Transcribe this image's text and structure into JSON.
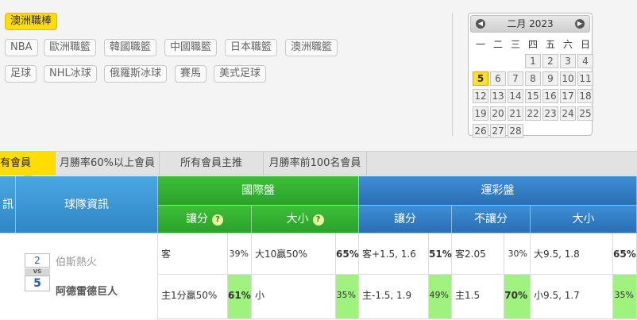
{
  "filters": {
    "active": "澳洲職棒",
    "row1": [
      "NBA",
      "歐洲職籃",
      "韓國職籃",
      "中國職籃",
      "日本職籃",
      "澳洲職籃"
    ],
    "row2": [
      "足球",
      "NHL冰球",
      "俄羅斯冰球",
      "賽馬",
      "美式足球"
    ]
  },
  "calendar": {
    "month_label": "二月 2023",
    "weekdays": [
      "一",
      "二",
      "三",
      "四",
      "五",
      "六",
      "日"
    ],
    "days": [
      "1",
      "2",
      "3",
      "4",
      "5",
      "6",
      "7",
      "8",
      "9",
      "10",
      "11",
      "12",
      "13",
      "14",
      "15",
      "16",
      "17",
      "18",
      "19",
      "20",
      "21",
      "22",
      "23",
      "24",
      "25",
      "26",
      "27",
      "28"
    ],
    "today": "5"
  },
  "tabs": [
    "有會員",
    "月勝率60%以上會員",
    "所有會員主推",
    "月勝率前100名會員"
  ],
  "table": {
    "col_left": "訊",
    "col_team": "球隊資訊",
    "group_intl": "國際盤",
    "group_sports": "運彩盤",
    "sub_intl_spread": "讓分",
    "sub_intl_total": "大小",
    "sub_sp_spread": "讓分",
    "sub_sp_nospread": "不讓分",
    "sub_sp_total": "大小",
    "help_icon": "?"
  },
  "game": {
    "away_score": "2",
    "home_score": "5",
    "vs": "VS",
    "away_team": "伯斯熱火",
    "home_team": "阿德雷德巨人",
    "row_away": {
      "intl_spread": "客",
      "intl_spread_pct": "39%",
      "intl_total": "大10贏50%",
      "intl_total_pct": "65%",
      "sp_spread": "客+1.5, 1.6",
      "sp_spread_pct": "51%",
      "sp_nospread": "客2.05",
      "sp_nospread_pct": "30%",
      "sp_total": "大9.5, 1.8",
      "sp_total_pct": "65%"
    },
    "row_home": {
      "intl_spread": "主1分贏50%",
      "intl_spread_pct": "61%",
      "intl_total": "小",
      "intl_total_pct": "35%",
      "sp_spread": "主-1.5, 1.9",
      "sp_spread_pct": "49%",
      "sp_nospread": "主1.5",
      "sp_nospread_pct": "70%",
      "sp_total": "小9.5, 1.7",
      "sp_total_pct": "35%"
    }
  },
  "colors": {
    "accent_yellow": "#ffdd00",
    "header_green": "#2ba12a",
    "header_blue": "#2f86c7",
    "highlight_green": "#9ff27e"
  }
}
